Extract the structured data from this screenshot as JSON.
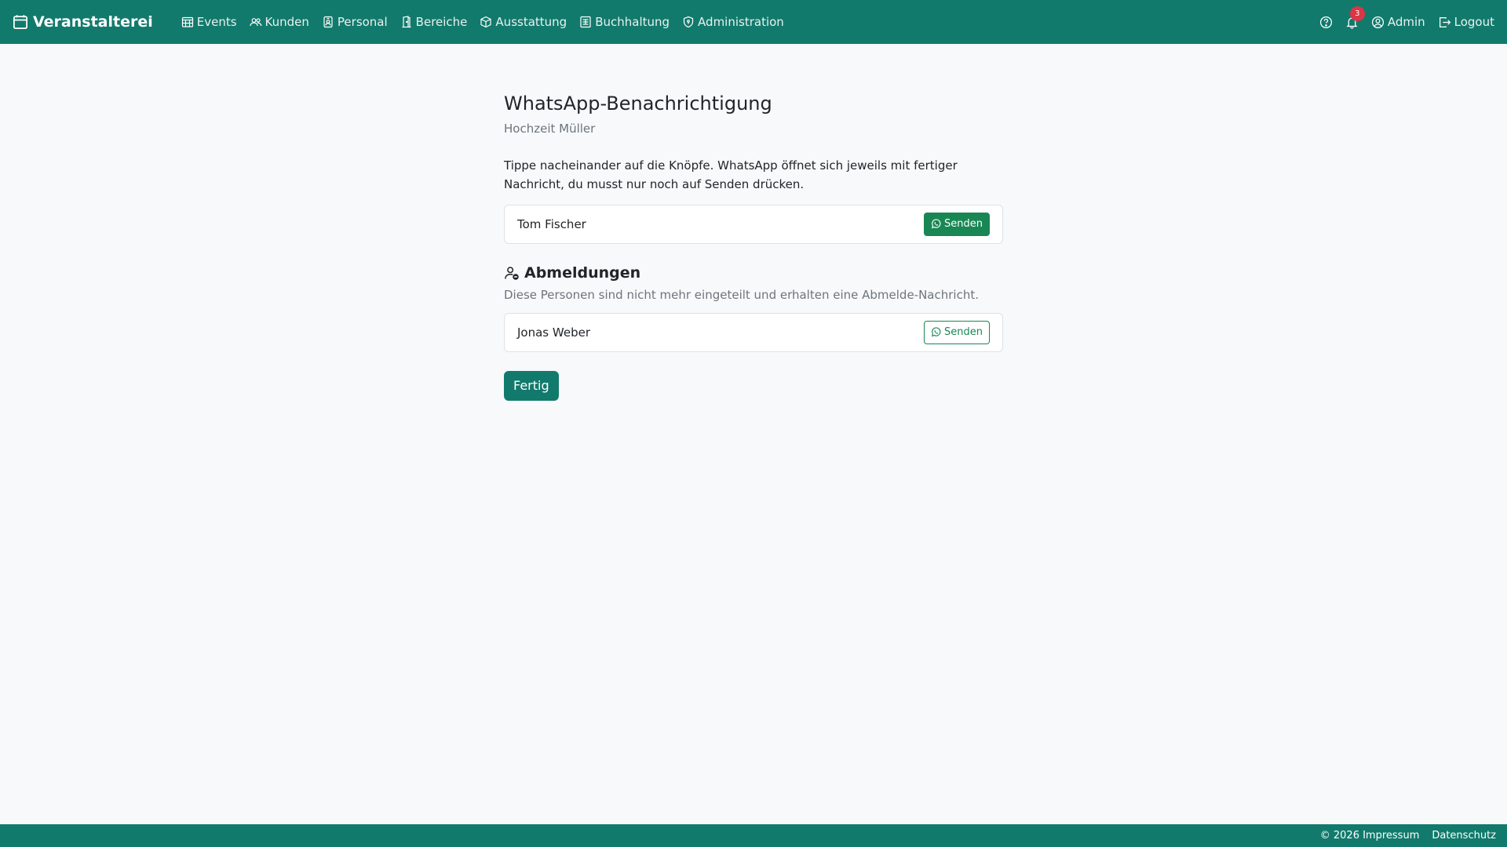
{
  "navbar": {
    "brand": "Veranstalterei",
    "links": [
      {
        "label": "Events",
        "icon": "calendar-grid-icon"
      },
      {
        "label": "Kunden",
        "icon": "people-icon"
      },
      {
        "label": "Personal",
        "icon": "person-badge-icon"
      },
      {
        "label": "Bereiche",
        "icon": "door-icon"
      },
      {
        "label": "Ausstattung",
        "icon": "box-icon"
      },
      {
        "label": "Buchhaltung",
        "icon": "ledger-icon"
      },
      {
        "label": "Administration",
        "icon": "shield-icon"
      }
    ],
    "notifications_count": "3",
    "user_label": "Admin",
    "logout_label": "Logout"
  },
  "page": {
    "title": "WhatsApp-Benachrichtigung",
    "subtitle": "Hochzeit Müller",
    "intro": "Tippe nacheinander auf die Knöpfe. WhatsApp öffnet sich jeweils mit fertiger Nachricht, du musst nur noch auf Senden drücken."
  },
  "recipients": [
    {
      "name": "Tom Fischer",
      "button_label": "Senden"
    }
  ],
  "cancellations": {
    "title": "Abmeldungen",
    "description": "Diese Personen sind nicht mehr eingeteilt und erhalten eine Abmelde-Nachricht.",
    "items": [
      {
        "name": "Jonas Weber",
        "button_label": "Senden"
      }
    ]
  },
  "done_label": "Fertig",
  "footer": {
    "impressum": "© 2026 Impressum",
    "datenschutz": "Datenschutz"
  },
  "colors": {
    "primary": "#127a6c",
    "whatsapp_green": "#198754",
    "badge": "#dc3545"
  }
}
